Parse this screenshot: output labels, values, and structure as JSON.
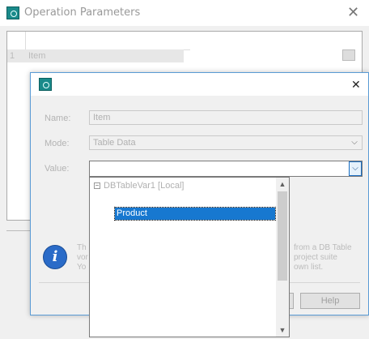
{
  "background_window": {
    "title": "Operation Parameters",
    "grid": {
      "row_number": "1",
      "row_text": "Item"
    }
  },
  "dialog": {
    "name_label": "Name:",
    "name_value": "Item",
    "mode_label": "Mode:",
    "mode_value": "Table Data",
    "value_label": "Value:",
    "value_value": "",
    "info_lines_left": [
      "Th",
      "vor",
      "Yo"
    ],
    "info_lines_right": [
      "from a DB Table",
      "project suite",
      "own list."
    ],
    "help_label": "Help"
  },
  "dropdown": {
    "tree_node": "DBTableVar1 [Local]",
    "selected_item": "Product"
  },
  "icons": {
    "app": "app-icon",
    "close": "close-icon",
    "info": "info-icon",
    "chevron": "chevron-down-icon"
  }
}
